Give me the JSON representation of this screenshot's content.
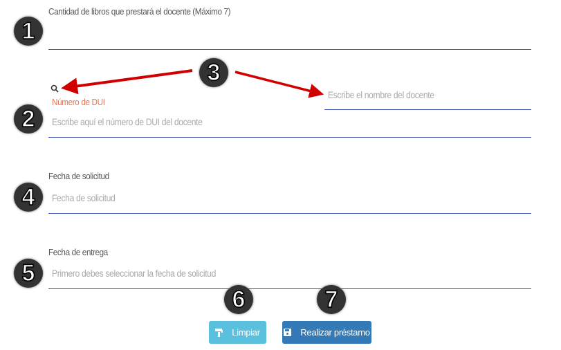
{
  "fields": {
    "cantidad": {
      "label": "Cantidad de libros que prestará el docente (Máximo 7)"
    },
    "dui": {
      "label": "Número de DUI",
      "placeholder": "Escribe aquí el número de DUI del docente"
    },
    "nombre": {
      "placeholder": "Escribe el nombre del docente"
    },
    "fecha_solicitud": {
      "label": "Fecha de solicitud",
      "placeholder": "Fecha de solicitud"
    },
    "fecha_entrega": {
      "label": "Fecha de entrega",
      "placeholder": "Primero debes seleccionar la fecha de solicitud"
    }
  },
  "buttons": {
    "limpiar": "Limpiar",
    "realizar": "Realizar préstamo"
  },
  "badges": [
    "1",
    "2",
    "3",
    "4",
    "5",
    "6",
    "7"
  ],
  "colors": {
    "accent_line": "#3f51b5",
    "info": "#5bc0de",
    "primary": "#337ab7",
    "dui_label": "#e8755a",
    "arrow": "#d00000"
  }
}
